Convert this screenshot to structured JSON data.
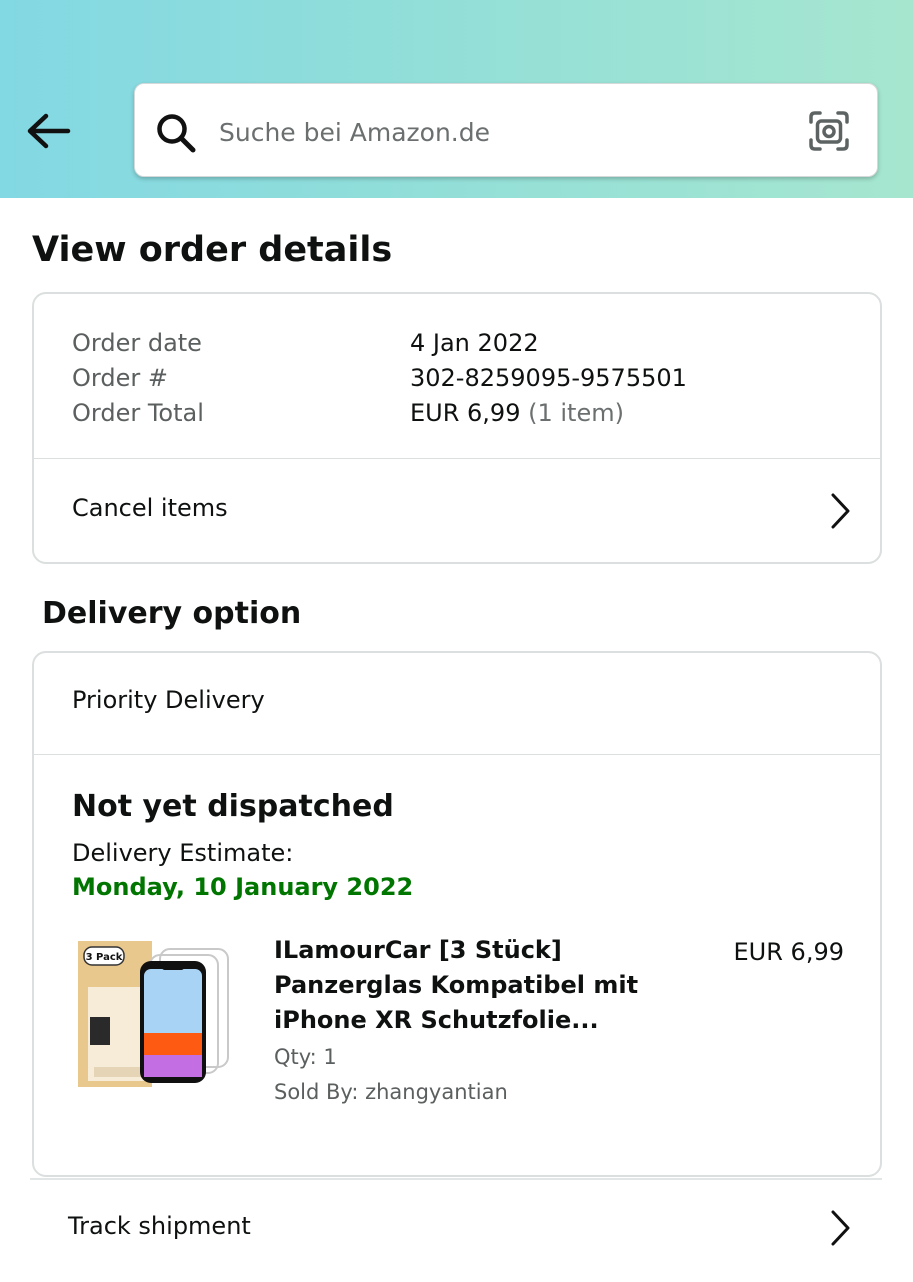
{
  "header": {
    "search": {
      "placeholder": "Suche bei Amazon.de",
      "value": ""
    }
  },
  "page": {
    "title": "View order details"
  },
  "order_summary": {
    "rows": [
      {
        "label": "Order date",
        "value": "4 Jan 2022"
      },
      {
        "label": "Order #",
        "value": "302-8259095-9575501"
      },
      {
        "label": "Order Total",
        "value": "EUR 6,99",
        "extra": "(1 item)"
      }
    ],
    "cancel_label": "Cancel items"
  },
  "delivery": {
    "section_title": "Delivery option",
    "option": "Priority Delivery",
    "status": "Not yet dispatched",
    "estimate_label": "Delivery Estimate:",
    "estimate_date": "Monday, 10 January 2022",
    "status_color": "#007600"
  },
  "product": {
    "title": "ILamourCar [3 Stück] Panzerglas Kompatibel mit iPhone XR Schutzfolie...",
    "price": "EUR 6,99",
    "qty": "Qty: 1",
    "sold_by": "Sold By: zhangyantian",
    "image_badge": "3 Pack"
  },
  "track_shipment_label": "Track shipment",
  "icons": [
    "back-arrow-icon",
    "search-icon",
    "camera-icon",
    "chevron-right-icon"
  ]
}
